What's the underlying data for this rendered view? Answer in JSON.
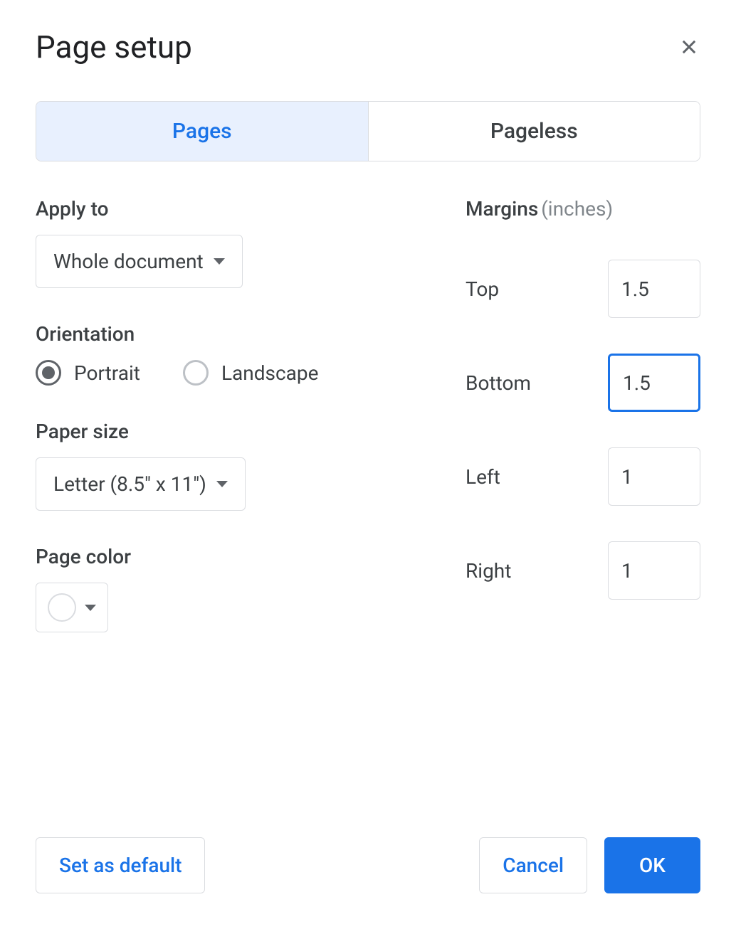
{
  "dialog": {
    "title": "Page setup"
  },
  "tabs": {
    "pages": "Pages",
    "pageless": "Pageless"
  },
  "applyTo": {
    "label": "Apply to",
    "value": "Whole document"
  },
  "orientation": {
    "label": "Orientation",
    "portrait": "Portrait",
    "landscape": "Landscape",
    "selected": "portrait"
  },
  "paperSize": {
    "label": "Paper size",
    "value": "Letter (8.5\" x 11\")"
  },
  "pageColor": {
    "label": "Page color",
    "value": "#ffffff"
  },
  "margins": {
    "label": "Margins",
    "unit": "(inches)",
    "top": {
      "label": "Top",
      "value": "1.5"
    },
    "bottom": {
      "label": "Bottom",
      "value": "1.5"
    },
    "left": {
      "label": "Left",
      "value": "1"
    },
    "right": {
      "label": "Right",
      "value": "1"
    }
  },
  "buttons": {
    "setDefault": "Set as default",
    "cancel": "Cancel",
    "ok": "OK"
  }
}
